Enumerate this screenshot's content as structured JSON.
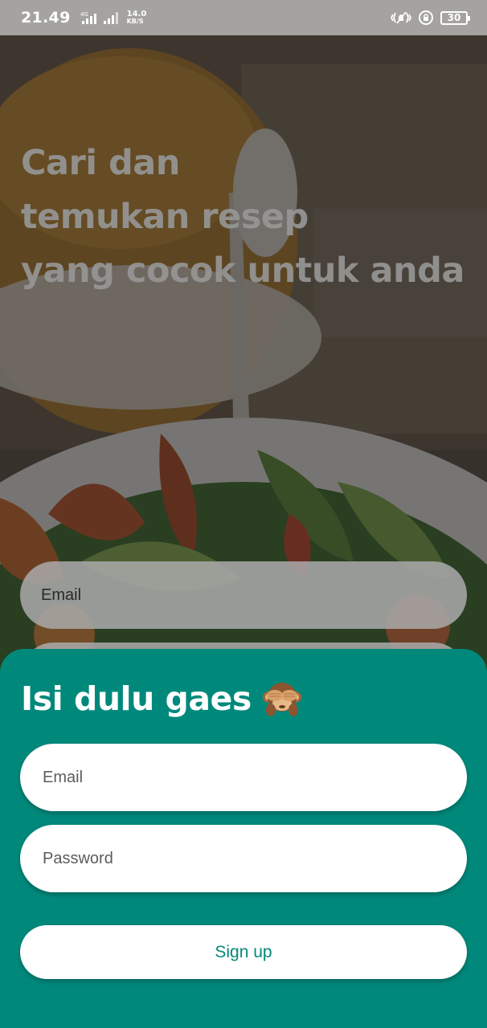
{
  "status_bar": {
    "time": "21.49",
    "network_label": "4G",
    "speed_value": "14.0",
    "speed_unit": "KB/S",
    "battery": "30",
    "icons": [
      "signal-4g-icon",
      "signal-icon",
      "vibrate-icon",
      "rotation-lock-icon",
      "battery-icon"
    ]
  },
  "hero": {
    "line1": "Cari dan",
    "line2": "temukan resep",
    "line3": "yang cocok untuk anda"
  },
  "background_form": {
    "email_placeholder": "Email"
  },
  "sheet": {
    "title": "Isi dulu gaes",
    "title_icon": "see-no-evil-monkey-icon",
    "email_placeholder": "Email",
    "password_placeholder": "Password",
    "submit_label": "Sign up"
  },
  "colors": {
    "accent": "#00897B",
    "surface": "#FFFFFF"
  }
}
